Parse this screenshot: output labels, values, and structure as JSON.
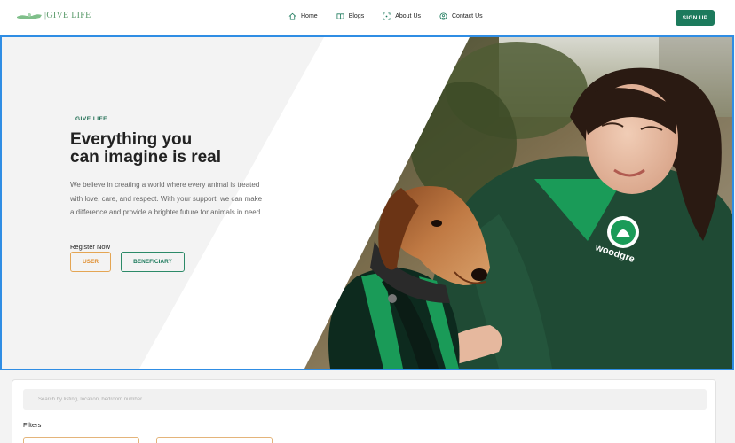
{
  "nav": {
    "logo_text": "GIVE LIFE",
    "links": [
      {
        "label": "Home",
        "icon": "home-icon"
      },
      {
        "label": "Blogs",
        "icon": "book-icon"
      },
      {
        "label": "About Us",
        "icon": "dots-icon"
      },
      {
        "label": "Contact Us",
        "icon": "contact-icon"
      }
    ],
    "signup_label": "SIGN UP"
  },
  "hero": {
    "tagline": "GIVE LIFE",
    "headline_line1": "Everything you",
    "headline_line2": "can imagine is real",
    "description": "We believe in creating a world where every animal is treated with love, care, and respect. With your support, we can make a difference and provide a brighter future for animals in need.",
    "register_label": "Register Now",
    "user_button": "USER",
    "beneficiary_button": "BENEFICIARY",
    "photo_jacket_text": "woodgre"
  },
  "search": {
    "placeholder": "Search by listing, location, bedroom number..."
  },
  "filters": {
    "label": "Filters"
  },
  "colors": {
    "brand_green": "#1c7a5c",
    "accent_orange": "#e08e2e",
    "selection_blue": "#2f8de4"
  }
}
